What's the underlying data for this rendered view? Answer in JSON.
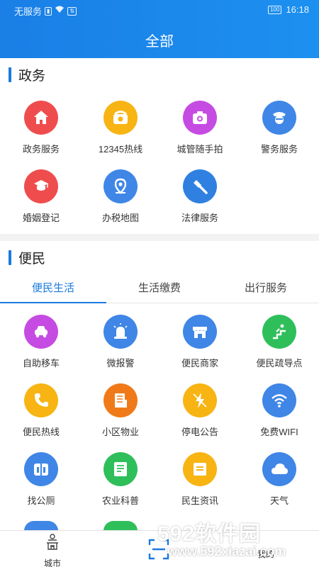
{
  "status_bar": {
    "carrier": "无服务",
    "time": "16:18",
    "battery": "100"
  },
  "header": {
    "title": "全部"
  },
  "gov_section": {
    "title": "政务",
    "items": [
      {
        "label": "政务服务",
        "icon": "home-icon",
        "color": "#ef4d4d"
      },
      {
        "label": "12345热线",
        "icon": "telephone-icon",
        "color": "#f7b413"
      },
      {
        "label": "城管随手拍",
        "icon": "camera-icon",
        "color": "#c64be3"
      },
      {
        "label": "警务服务",
        "icon": "police-icon",
        "color": "#3f86e6"
      },
      {
        "label": "婚姻登记",
        "icon": "marriage-icon",
        "color": "#ef4d4d"
      },
      {
        "label": "办税地图",
        "icon": "map-pin-icon",
        "color": "#3f86e6"
      },
      {
        "label": "法律服务",
        "icon": "gavel-icon",
        "color": "#2f80e0"
      }
    ]
  },
  "civ_section": {
    "title": "便民",
    "tabs": [
      "便民生活",
      "生活缴费",
      "出行服务"
    ],
    "active_tab": 0,
    "items": [
      {
        "label": "自助移车",
        "icon": "car-icon",
        "color": "#c64be3"
      },
      {
        "label": "微报警",
        "icon": "siren-icon",
        "color": "#3f86e6"
      },
      {
        "label": "便民商家",
        "icon": "shop-icon",
        "color": "#3f86e6"
      },
      {
        "label": "便民疏导点",
        "icon": "stairs-icon",
        "color": "#2fbf5a"
      },
      {
        "label": "便民热线",
        "icon": "phone-icon",
        "color": "#f7b413"
      },
      {
        "label": "小区物业",
        "icon": "building-icon",
        "color": "#f07a1a"
      },
      {
        "label": "停电公告",
        "icon": "power-icon",
        "color": "#f7b413"
      },
      {
        "label": "免费WIFI",
        "icon": "wifi-icon",
        "color": "#3f86e6"
      },
      {
        "label": "找公厕",
        "icon": "toilet-icon",
        "color": "#3f86e6"
      },
      {
        "label": "农业科普",
        "icon": "book-icon",
        "color": "#2fbf5a"
      },
      {
        "label": "民生资讯",
        "icon": "news-icon",
        "color": "#f7b413"
      },
      {
        "label": "天气",
        "icon": "cloud-icon",
        "color": "#3f86e6"
      }
    ]
  },
  "bottom_nav": {
    "city_label": "城市",
    "right_label": "我的"
  },
  "watermark": {
    "brand": "592软件园",
    "url": "www.592xiazai.com"
  }
}
